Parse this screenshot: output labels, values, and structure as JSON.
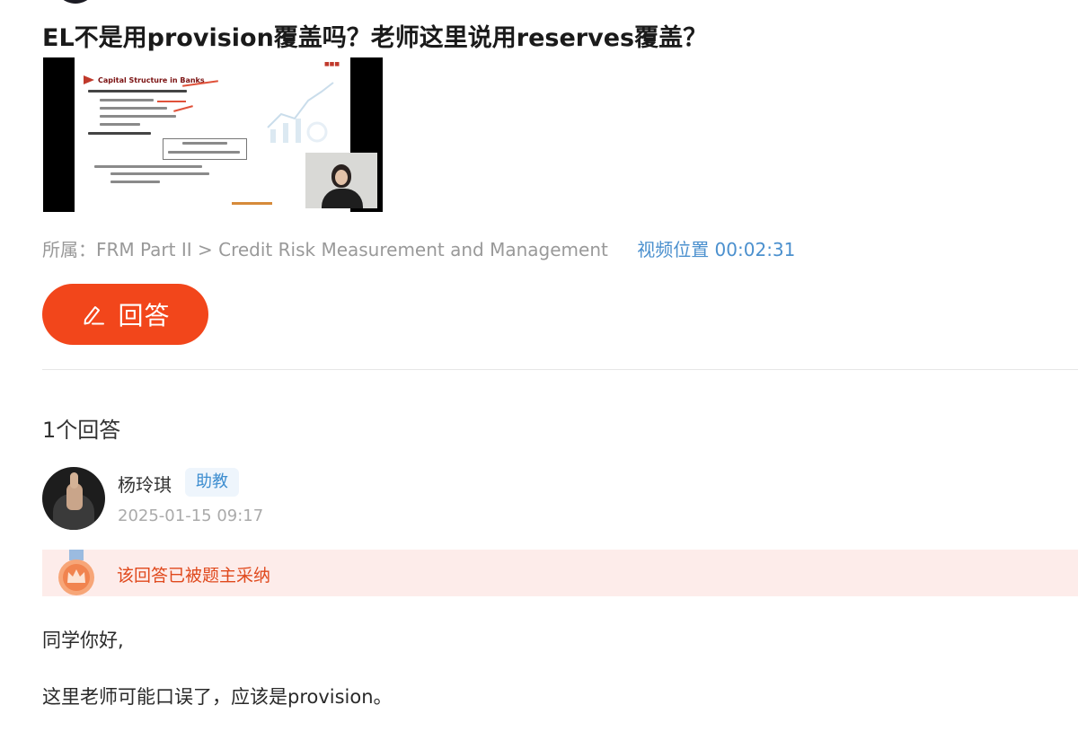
{
  "question": {
    "title": "EL不是用provision覆盖吗？老师这里说用reserves覆盖？",
    "category": "所属：FRM Part II > Credit Risk Measurement and Management",
    "video_position": "视频位置 00:02:31",
    "thumbnail": {
      "slide_title": "Capital Structure in Banks"
    }
  },
  "actions": {
    "answer_button_label": "回答",
    "answer_button_icon": "pencil-icon"
  },
  "answers": {
    "count_label": "1个回答",
    "items": [
      {
        "author": "杨玲琪",
        "role": "助教",
        "time": "2025-01-15 09:17",
        "adopted_label": "该回答已被题主采纳",
        "adopted_icon": "crown-medal-icon",
        "greeting": "同学你好,",
        "body": "这里老师可能口误了，应该是provision。"
      }
    ]
  },
  "colors": {
    "accent": "#f2461b",
    "link": "#4b90ce",
    "adopted_bg": "#fdecea",
    "adopted_text": "#e0491d"
  }
}
